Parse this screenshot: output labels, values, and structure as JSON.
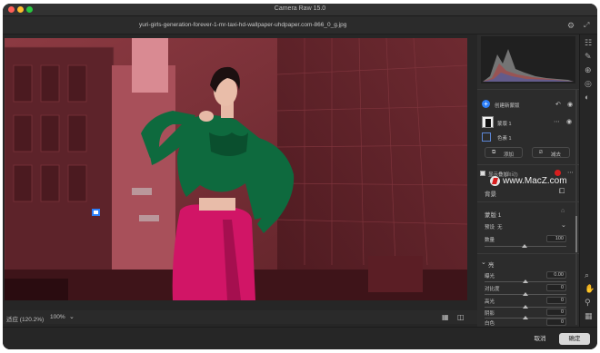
{
  "window": {
    "title": "Camera Raw 15.0",
    "filename": "yuri-girls-generation-forever-1-mr-taxi-hd-wallpaper-uhdpaper.com-866_0_g.jpg"
  },
  "colors": {
    "mask_overlay": "#b8323c",
    "coat": "#0e6a3e",
    "skirt": "#d11566",
    "accent": "#2d7ff9",
    "ok_button": "#d9d9d9"
  },
  "masks": {
    "create_label": "创建新蒙版",
    "mask1_name": "蒙版 1",
    "subject_name": "色素 1",
    "add_label": "添加",
    "subtract_label": "减去",
    "overlay_label": "显示叠加",
    "overlay_setting": "(自动)"
  },
  "watermark": "www.MacZ.com",
  "background_label": "背景",
  "mask_section": {
    "title": "蒙版 1",
    "preset_label": "预设",
    "preset_value": "无",
    "amount_label": "数量",
    "amount_value": "100",
    "amount_level": 1.0
  },
  "light": {
    "title": "亮",
    "sliders": [
      {
        "label": "曝光",
        "value": "0.00"
      },
      {
        "label": "对比度",
        "value": "0"
      },
      {
        "label": "高光",
        "value": "0"
      },
      {
        "label": "阴影",
        "value": "0"
      },
      {
        "label": "白色",
        "value": "0"
      }
    ]
  },
  "bottom": {
    "fit_label": "适应 (120.2%)",
    "zoom_label": "100%"
  },
  "footer": {
    "cancel": "取消",
    "ok": "确定"
  }
}
